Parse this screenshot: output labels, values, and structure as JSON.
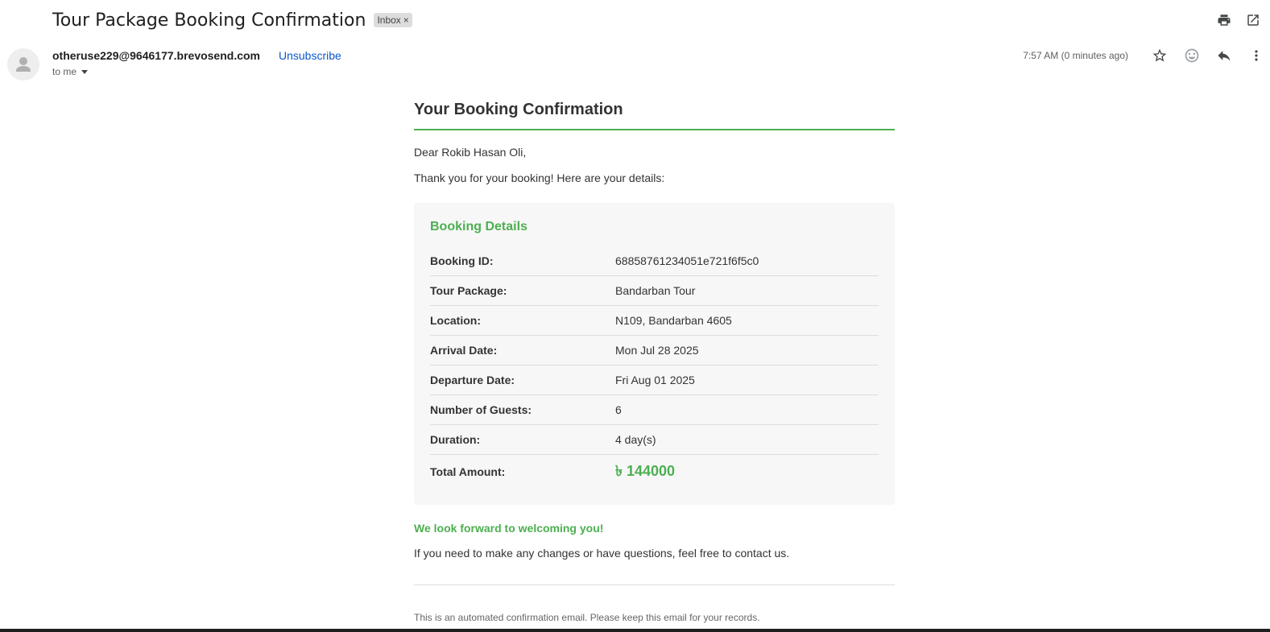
{
  "header": {
    "subject": "Tour Package Booking Confirmation",
    "label": "Inbox",
    "label_remove": "×"
  },
  "message": {
    "sender": "otheruse229@9646177.brevosend.com",
    "unsubscribe": "Unsubscribe",
    "to": "to me",
    "time": "7:57 AM (0 minutes ago)"
  },
  "icons": {
    "top": [
      "print-icon",
      "open-in-new-window-icon"
    ],
    "message": [
      "star-icon",
      "emoji-icon",
      "reply-icon",
      "more-vert-icon"
    ]
  },
  "email": {
    "title": "Your Booking Confirmation",
    "greeting": "Dear Rokib Hasan Oli,",
    "intro": "Thank you for your booking! Here are your details:",
    "details_heading": "Booking Details",
    "rows": [
      {
        "label": "Booking ID:",
        "value": "68858761234051e721f6f5c0"
      },
      {
        "label": "Tour Package:",
        "value": "Bandarban Tour"
      },
      {
        "label": "Location:",
        "value": "N109, Bandarban 4605"
      },
      {
        "label": "Arrival Date:",
        "value": "Mon Jul 28 2025"
      },
      {
        "label": "Departure Date:",
        "value": "Fri Aug 01 2025"
      },
      {
        "label": "Number of Guests:",
        "value": "6"
      },
      {
        "label": "Duration:",
        "value": "4 day(s)"
      },
      {
        "label": "Total Amount:",
        "value": "৳ 144000"
      }
    ],
    "closing": "We look forward to welcoming you!",
    "contact": "If you need to make any changes or have questions, feel free to contact us.",
    "footer": "This is an automated confirmation email. Please keep this email for your records."
  },
  "colors": {
    "accent_green": "#4caf50",
    "link_blue": "#0b57d0"
  }
}
